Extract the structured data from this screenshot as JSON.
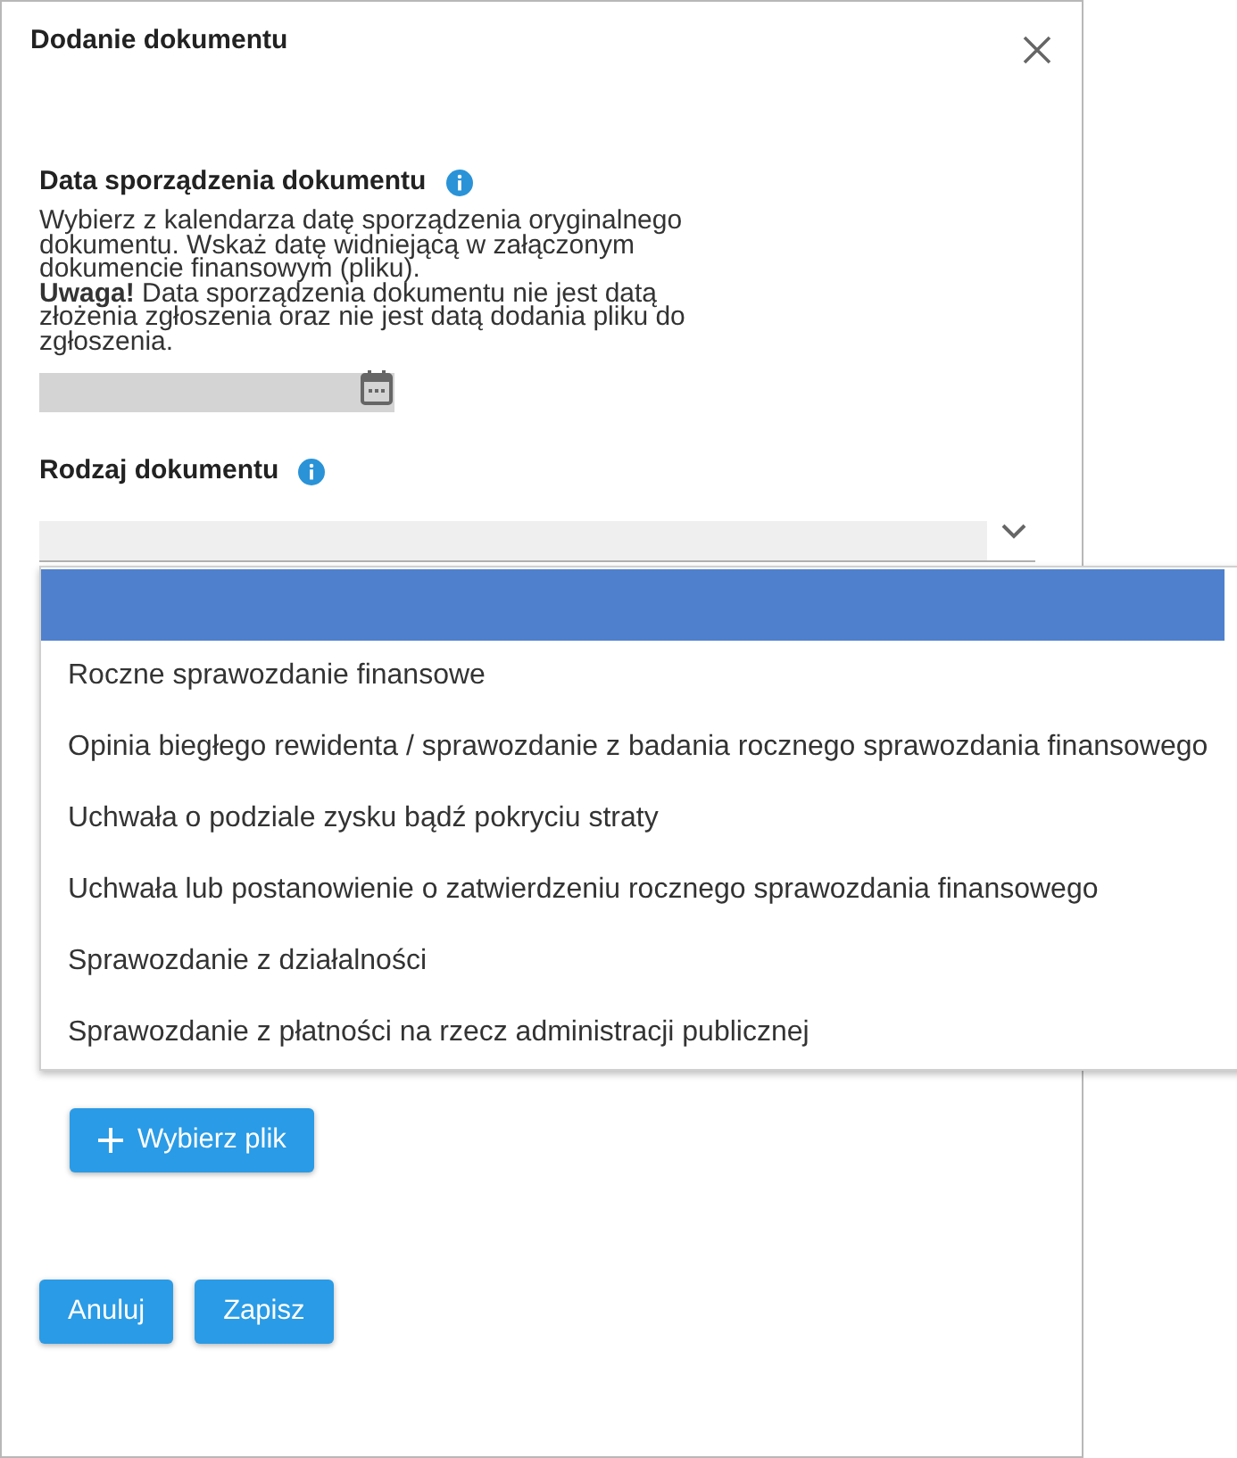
{
  "dialog": {
    "title": "Dodanie dokumentu"
  },
  "date_section": {
    "label": "Data sporządzenia dokumentu",
    "help": "Wybierz z kalendarza datę sporządzenia oryginalnego dokumentu. Wskaż datę widniejącą w załączonym dokumencie finansowym (pliku).",
    "warning": "**Uwaga!** Data sporządzenia dokumentu nie jest datą złożenia zgłoszenia oraz nie jest datą dodania pliku do zgłoszenia."
  },
  "type_section": {
    "label": "Rodzaj dokumentu",
    "expanded": true,
    "options": [
      {
        "selected": true
      },
      {
        "label": "Roczne sprawozdanie finansowe",
        "selected": false
      },
      {
        "label": "Opinia biegłego rewidenta / sprawozdanie z badania rocznego sprawozdania finansowego",
        "selected": false
      },
      {
        "label": "Uchwała o podziale zysku bądź pokryciu straty",
        "selected": false
      },
      {
        "label": "Uchwała lub postanowienie o zatwierdzeniu rocznego sprawozdania finansowego",
        "selected": false
      },
      {
        "label": "Sprawozdanie z działalności",
        "selected": false
      },
      {
        "label": "Sprawozdanie z płatności na rzecz administracji publicznej",
        "selected": false
      }
    ]
  },
  "upload_button": {
    "label": "Wybierz plik"
  },
  "actions": [
    {
      "label": "Anuluj"
    },
    {
      "label": "Zapisz"
    }
  ]
}
